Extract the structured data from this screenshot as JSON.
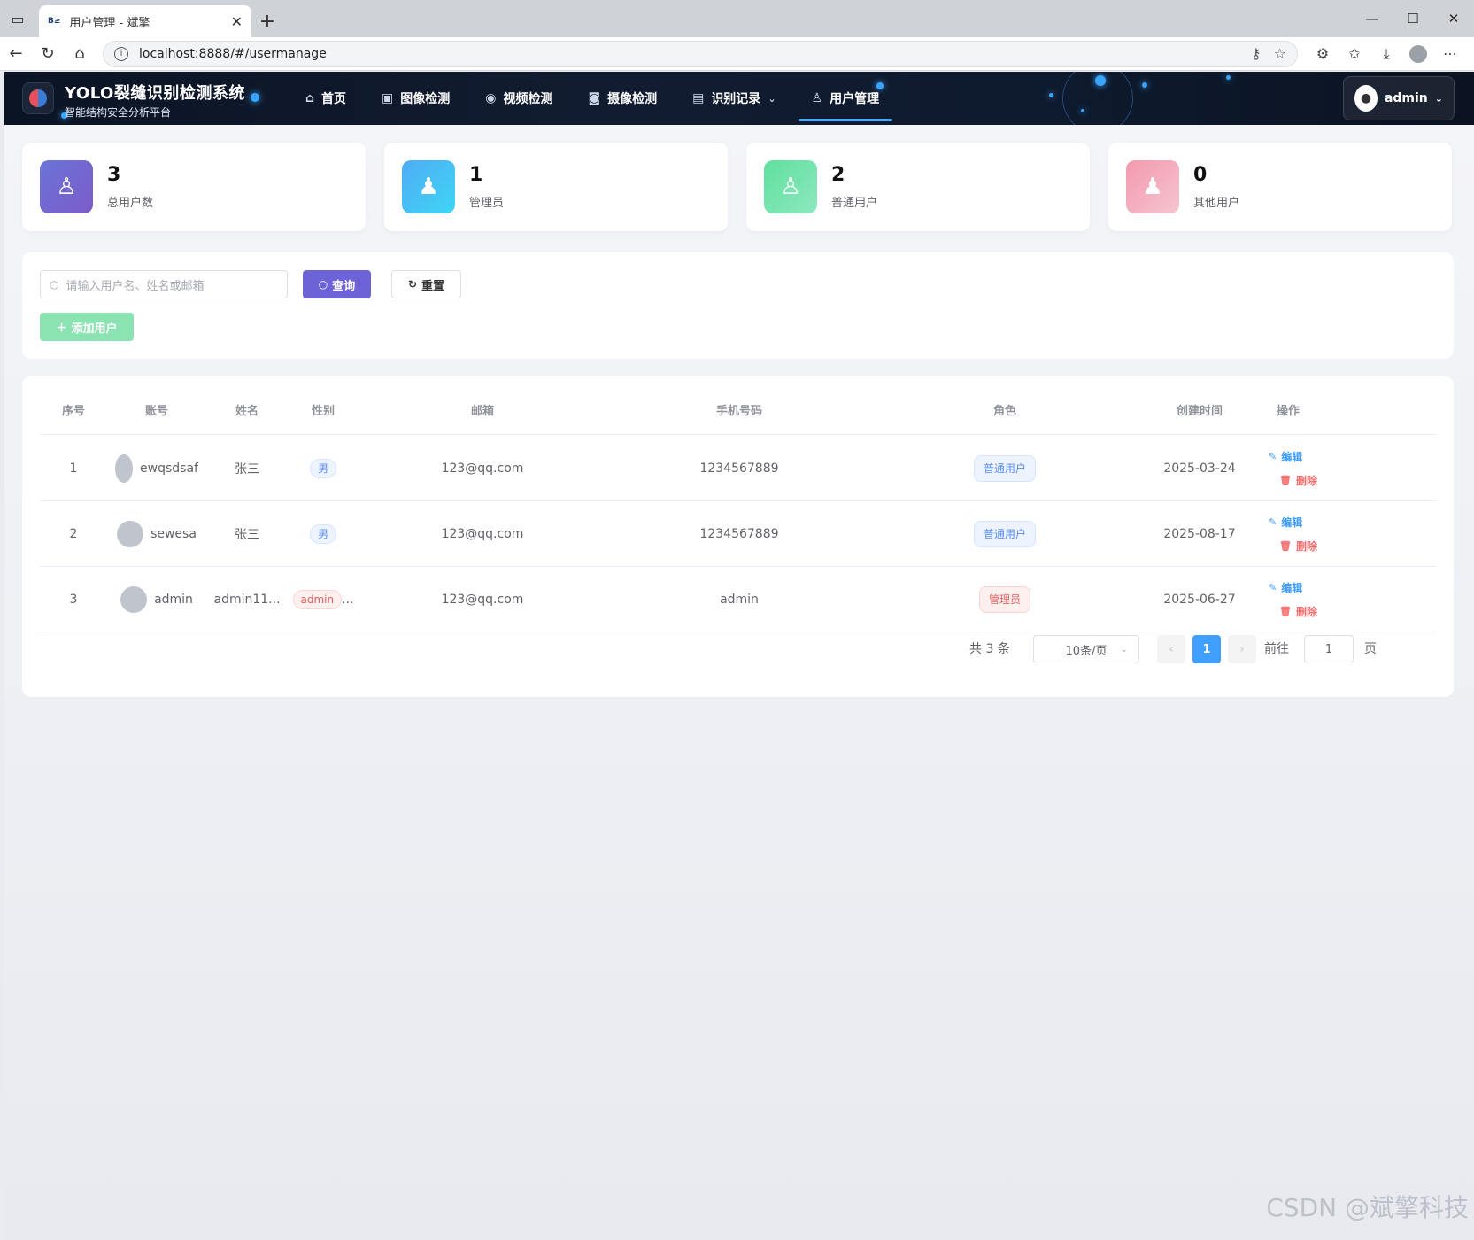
{
  "browser": {
    "tab_title": "用户管理 - 斌擎",
    "tab_favicon": "B≥",
    "url": "localhost:8888/#/usermanage"
  },
  "header": {
    "title": "YOLO裂缝识别检测系统",
    "subtitle": "智能结构安全分析平台",
    "nav": [
      {
        "label": "首页",
        "icon": "home-icon"
      },
      {
        "label": "图像检测",
        "icon": "image-icon"
      },
      {
        "label": "视频检测",
        "icon": "video-icon"
      },
      {
        "label": "摄像检测",
        "icon": "camera-icon"
      },
      {
        "label": "识别记录",
        "icon": "document-icon"
      },
      {
        "label": "用户管理",
        "icon": "user-icon",
        "active": true
      }
    ],
    "user": "admin"
  },
  "stats": [
    {
      "value": "3",
      "label": "总用户数",
      "color": "#7a66d9"
    },
    {
      "value": "1",
      "label": "管理员",
      "color": "#4fb6f5"
    },
    {
      "value": "2",
      "label": "普通用户",
      "color": "#6fdda6"
    },
    {
      "value": "0",
      "label": "其他用户",
      "color": "#f2a0b3"
    }
  ],
  "search": {
    "placeholder": "请输入用户名、姓名或邮箱",
    "query_label": "查询",
    "reset_label": "重置",
    "add_label": "添加用户"
  },
  "table": {
    "columns": [
      "序号",
      "账号",
      "姓名",
      "性别",
      "邮箱",
      "手机号码",
      "角色",
      "创建时间",
      "操作"
    ],
    "rows": [
      {
        "index": "1",
        "account": "ewqsdsaf",
        "name": "张三",
        "gender": "男",
        "email": "123@qq.com",
        "phone": "1234567889",
        "role": "普通用户",
        "created": "2025-03-24"
      },
      {
        "index": "2",
        "account": "sewesa",
        "name": "张三",
        "gender": "男",
        "email": "123@qq.com",
        "phone": "1234567889",
        "role": "普通用户",
        "created": "2025-08-17"
      },
      {
        "index": "3",
        "account": "admin",
        "name": "admin11...",
        "gender": "admin",
        "gender_suffix": "...",
        "email": "123@qq.com",
        "phone": "admin",
        "role": "管理员",
        "created": "2025-06-27"
      }
    ],
    "edit_label": "编辑",
    "delete_label": "删除"
  },
  "pagination": {
    "total": "共 3 条",
    "page_size": "10条/页",
    "current_page": "1",
    "goto_label": "前往",
    "goto_value": "1",
    "page_unit": "页"
  },
  "watermark": "CSDN @斌擎科技"
}
